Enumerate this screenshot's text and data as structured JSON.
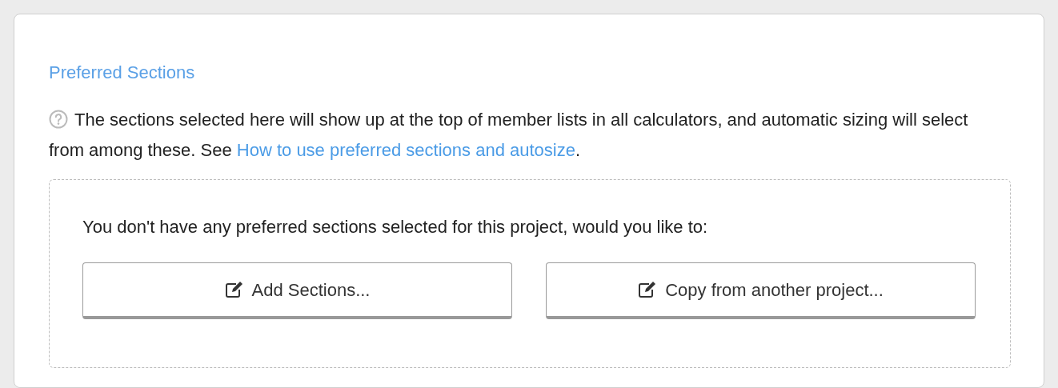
{
  "section": {
    "title": "Preferred Sections",
    "help": {
      "text": "The sections selected here will show up at the top of member lists in all calculators, and automatic sizing will select from among these. See ",
      "link": "How to use preferred sections and autosize",
      "suffix": "."
    },
    "empty_state": {
      "message": "You don't have any preferred sections selected for this project, would you like to:",
      "buttons": [
        {
          "label": "Add Sections..."
        },
        {
          "label": "Copy from another project..."
        }
      ]
    }
  }
}
